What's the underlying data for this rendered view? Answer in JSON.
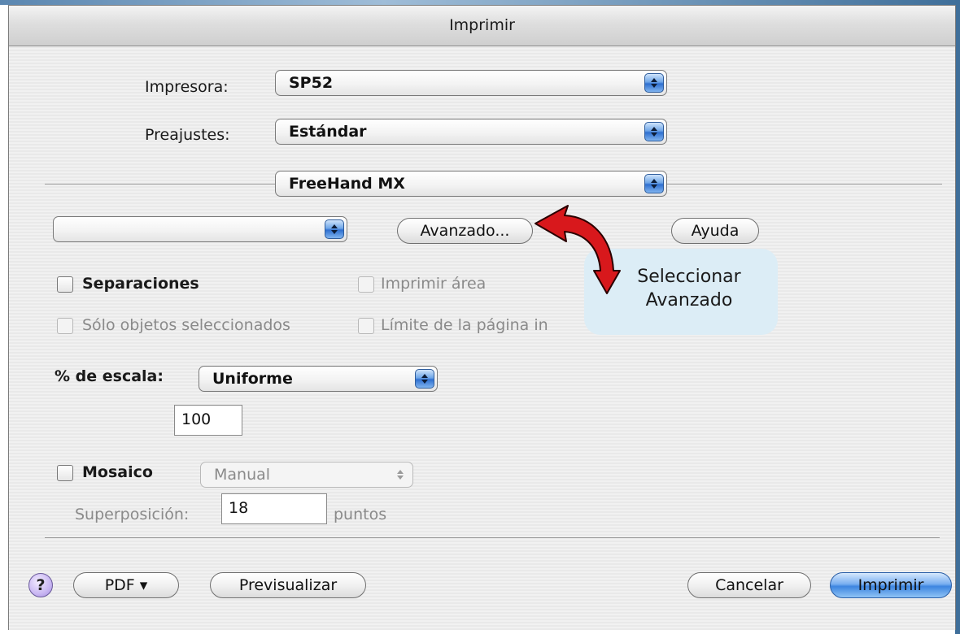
{
  "window": {
    "title": "Imprimir"
  },
  "printer": {
    "label": "Impresora:",
    "value": "SP52"
  },
  "presets": {
    "label": "Preajustes:",
    "value": "Estándar"
  },
  "panel": {
    "value": "FreeHand MX"
  },
  "options": {
    "empty_popup_value": "",
    "advanced_button": "Avanzado...",
    "help_button": "Ayuda"
  },
  "checkboxes": {
    "separations": {
      "label": "Separaciones",
      "checked": false,
      "enabled": true
    },
    "print_area": {
      "label": "Imprimir área",
      "checked": false,
      "enabled": false
    },
    "selected_only": {
      "label": "Sólo objetos seleccionados",
      "checked": false,
      "enabled": false
    },
    "page_limit": {
      "label": "Límite de la página in",
      "checked": false,
      "enabled": false
    }
  },
  "annotation": {
    "line1": "Seleccionar",
    "line2": "Avanzado"
  },
  "scale": {
    "label": "% de escala:",
    "mode": "Uniforme",
    "value": "100"
  },
  "tiling": {
    "label": "Mosaico",
    "checked": false,
    "mode": "Manual",
    "overlap_label": "Superposición:",
    "overlap_value": "18",
    "unit": "puntos"
  },
  "footer": {
    "help_icon": "?",
    "pdf_button": "PDF ▾",
    "preview_button": "Previsualizar",
    "cancel_button": "Cancelar",
    "print_button": "Imprimir"
  },
  "colors": {
    "callout_bg": "#dcedf6",
    "arrow": "#d8181c",
    "primary_button": "#3d85e0"
  }
}
